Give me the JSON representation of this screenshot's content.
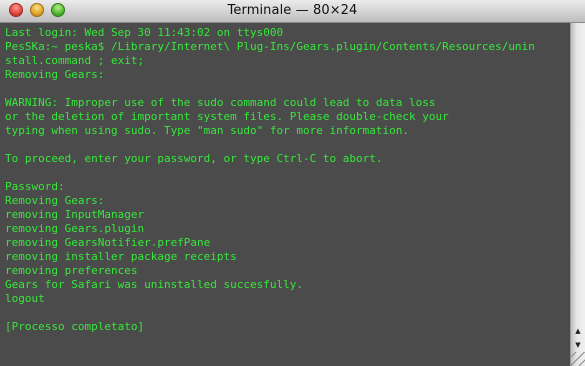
{
  "window": {
    "title": "Terminale — 80×24"
  },
  "terminal": {
    "lines": [
      "Last login: Wed Sep 30 11:43:02 on ttys000",
      "PesSKa:~ peska$ /Library/Internet\\ Plug-Ins/Gears.plugin/Contents/Resources/unin",
      "stall.command ; exit;",
      "Removing Gears:",
      "",
      "WARNING: Improper use of the sudo command could lead to data loss",
      "or the deletion of important system files. Please double-check your",
      "typing when using sudo. Type \"man sudo\" for more information.",
      "",
      "To proceed, enter your password, or type Ctrl-C to abort.",
      "",
      "Password:",
      "Removing Gears:",
      "removing InputManager",
      "removing Gears.plugin",
      "removing GearsNotifier.prefPane",
      "removing installer package receipts",
      "removing preferences",
      "Gears for Safari was uninstalled succesfully.",
      "logout",
      "",
      "[Processo completato]"
    ]
  },
  "colors": {
    "terminal_background": "#4b4b4b",
    "terminal_text": "#35e83a"
  },
  "icons": {
    "close": "close-button-icon",
    "minimize": "minimize-button-icon",
    "zoom": "zoom-button-icon",
    "scroll_up": "▲",
    "scroll_down": "▼"
  }
}
